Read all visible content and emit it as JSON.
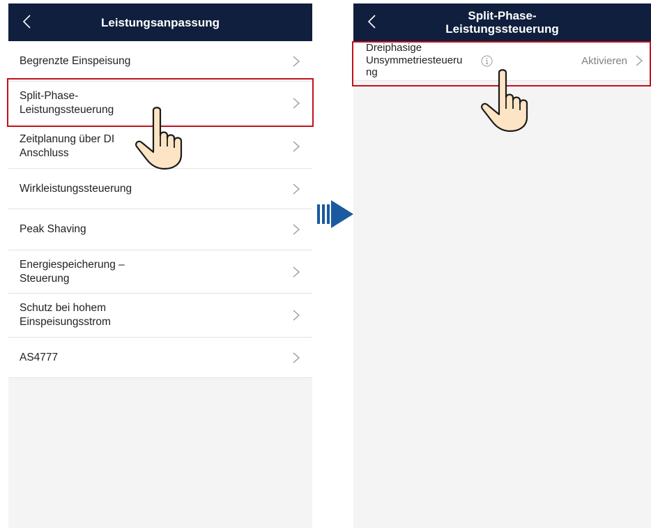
{
  "left_screen": {
    "title": "Leistungsanpassung",
    "items": [
      {
        "line1": "Begrenzte Einspeisung",
        "line2": ""
      },
      {
        "line1": "Split-Phase-",
        "line2": "Leistungssteuerung"
      },
      {
        "line1": "Zeitplanung über DI",
        "line2": "Anschluss"
      },
      {
        "line1": "Wirkleistungssteuerung",
        "line2": ""
      },
      {
        "line1": "Peak Shaving",
        "line2": ""
      },
      {
        "line1": "Energiespeicherung –",
        "line2": "Steuerung"
      },
      {
        "line1": "Schutz bei hohem",
        "line2": "Einspeisungsstrom"
      },
      {
        "line1": "AS4777",
        "line2": ""
      }
    ]
  },
  "right_screen": {
    "title_line1": "Split-Phase-",
    "title_line2": "Leistungssteuerung",
    "item": {
      "line1": "Dreiphasige",
      "line2": "Unsymmetriesteueru",
      "line3": "ng",
      "value": "Aktivieren"
    }
  },
  "colors": {
    "nav_bg": "#0f1f3d",
    "highlight": "#c0121d",
    "arrow": "#1a5a9e",
    "hand_fill": "#fde4c4"
  },
  "icons": [
    "back-chevron-icon",
    "chevron-right-icon",
    "info-icon",
    "pointing-hand-icon",
    "arrow-right-icon"
  ]
}
